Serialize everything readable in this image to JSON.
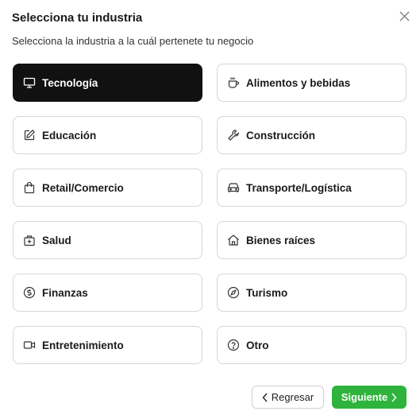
{
  "dialog": {
    "title": "Selecciona tu industria",
    "subtitle": "Selecciona la industria a la cuál pertenete tu negocio",
    "close_icon": "close-icon"
  },
  "options": [
    {
      "label": "Tecnología",
      "icon": "monitor-icon",
      "selected": true
    },
    {
      "label": "Alimentos y bebidas",
      "icon": "coffee-cup-icon",
      "selected": false
    },
    {
      "label": "Educación",
      "icon": "edit-icon",
      "selected": false
    },
    {
      "label": "Construcción",
      "icon": "wrench-icon",
      "selected": false
    },
    {
      "label": "Retail/Comercio",
      "icon": "shopping-bag-icon",
      "selected": false
    },
    {
      "label": "Transporte/Logística",
      "icon": "car-icon",
      "selected": false
    },
    {
      "label": "Salud",
      "icon": "medical-kit-icon",
      "selected": false
    },
    {
      "label": "Bienes raíces",
      "icon": "house-icon",
      "selected": false
    },
    {
      "label": "Finanzas",
      "icon": "dollar-coin-icon",
      "selected": false
    },
    {
      "label": "Turismo",
      "icon": "compass-icon",
      "selected": false
    },
    {
      "label": "Entretenimiento",
      "icon": "video-camera-icon",
      "selected": false
    },
    {
      "label": "Otro",
      "icon": "help-circle-icon",
      "selected": false
    }
  ],
  "footer": {
    "back_label": "Regresar",
    "next_label": "Siguiente"
  },
  "colors": {
    "selected_bg": "#111111",
    "primary": "#2eb43c",
    "border": "#d6d6d6"
  }
}
